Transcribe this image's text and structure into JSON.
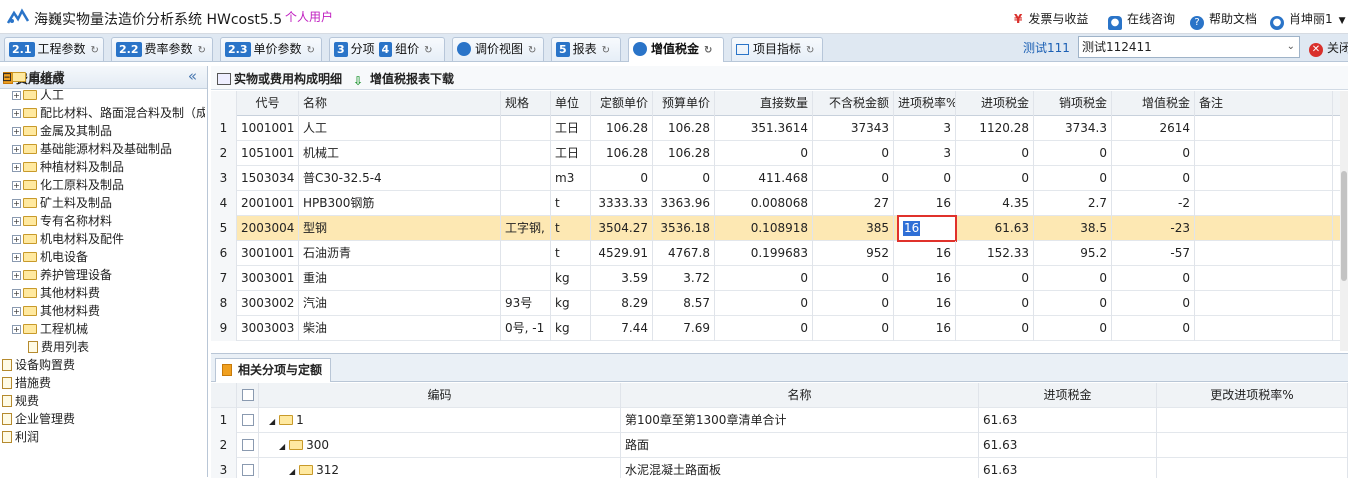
{
  "app": {
    "title": "海巍实物量法造价分析系统 HWcost5.5",
    "user_type": "个人用户"
  },
  "topbar": {
    "invoice": "发票与收益",
    "consult": "在线咨询",
    "help": "帮助文档",
    "user": "肖坤丽1"
  },
  "tabs": [
    {
      "num": "2.1",
      "label": "工程参数"
    },
    {
      "num": "2.2",
      "label": "费率参数"
    },
    {
      "num": "2.3",
      "label": "单价参数"
    },
    {
      "num": "3",
      "label": "分项"
    },
    {
      "num": "4",
      "label": "组价"
    },
    {
      "num": "",
      "label": "调价视图"
    },
    {
      "num": "5",
      "label": "报表"
    },
    {
      "num": "",
      "label": "增值税金"
    },
    {
      "num": "",
      "label": "项目指标"
    }
  ],
  "project": {
    "label": "测试111",
    "value": "测试112411",
    "close": "关闭"
  },
  "left": {
    "header": "费用组成",
    "root": "直接费",
    "items": [
      "人工",
      "配比材料、路面混合料及制（成）品",
      "金属及其制品",
      "基础能源材料及基础制品",
      "种植材料及制品",
      "化工原料及制品",
      "矿土料及制品",
      "专有名称材料",
      "机电材料及配件",
      "机电设备",
      "养护管理设备",
      "其他材料费",
      "其他材料费",
      "工程机械"
    ],
    "leaf": "费用列表",
    "tail": [
      "设备购置费",
      "措施费",
      "规费",
      "企业管理费",
      "利润"
    ]
  },
  "toolbar": {
    "detail": "实物或费用构成明细",
    "download": "增值税报表下载"
  },
  "grid": {
    "headers": [
      "代号",
      "名称",
      "规格",
      "单位",
      "定额单价",
      "预算单价",
      "直接数量",
      "不含税金额",
      "进项税率%",
      "进项税金",
      "销项税金",
      "增值税金",
      "备注"
    ],
    "rows": [
      {
        "n": "1",
        "code": "1001001",
        "name": "人工",
        "spec": "",
        "unit": "工日",
        "qp": "106.28",
        "bp": "106.28",
        "qty": "351.3614",
        "amt": "37343",
        "rate": "3",
        "in": "1120.28",
        "out": "3734.3",
        "vat": "2614"
      },
      {
        "n": "2",
        "code": "1051001",
        "name": "机械工",
        "spec": "",
        "unit": "工日",
        "qp": "106.28",
        "bp": "106.28",
        "qty": "0",
        "amt": "0",
        "rate": "3",
        "in": "0",
        "out": "0",
        "vat": "0"
      },
      {
        "n": "3",
        "code": "1503034",
        "name": "普C30-32.5-4",
        "spec": "",
        "unit": "m3",
        "qp": "0",
        "bp": "0",
        "qty": "411.468",
        "amt": "0",
        "rate": "0",
        "in": "0",
        "out": "0",
        "vat": "0"
      },
      {
        "n": "4",
        "code": "2001001",
        "name": "HPB300钢筋",
        "spec": "",
        "unit": "t",
        "qp": "3333.33",
        "bp": "3363.96",
        "qty": "0.008068",
        "amt": "27",
        "rate": "16",
        "in": "4.35",
        "out": "2.7",
        "vat": "-2"
      },
      {
        "n": "5",
        "code": "2003004",
        "name": "型钢",
        "spec": "工字钢,",
        "unit": "t",
        "qp": "3504.27",
        "bp": "3536.18",
        "qty": "0.108918",
        "amt": "385",
        "rate": "16",
        "in": "61.63",
        "out": "38.5",
        "vat": "-23"
      },
      {
        "n": "6",
        "code": "3001001",
        "name": "石油沥青",
        "spec": "",
        "unit": "t",
        "qp": "4529.91",
        "bp": "4767.8",
        "qty": "0.199683",
        "amt": "952",
        "rate": "16",
        "in": "152.33",
        "out": "95.2",
        "vat": "-57"
      },
      {
        "n": "7",
        "code": "3003001",
        "name": "重油",
        "spec": "",
        "unit": "kg",
        "qp": "3.59",
        "bp": "3.72",
        "qty": "0",
        "amt": "0",
        "rate": "16",
        "in": "0",
        "out": "0",
        "vat": "0"
      },
      {
        "n": "8",
        "code": "3003002",
        "name": "汽油",
        "spec": "93号",
        "unit": "kg",
        "qp": "8.29",
        "bp": "8.57",
        "qty": "0",
        "amt": "0",
        "rate": "16",
        "in": "0",
        "out": "0",
        "vat": "0"
      },
      {
        "n": "9",
        "code": "3003003",
        "name": "柴油",
        "spec": "0号, -1",
        "unit": "kg",
        "qp": "7.44",
        "bp": "7.69",
        "qty": "0",
        "amt": "0",
        "rate": "16",
        "in": "0",
        "out": "0",
        "vat": "0"
      }
    ],
    "editing_value": "16"
  },
  "bottom": {
    "tab": "相关分项与定额",
    "headers": [
      "编码",
      "名称",
      "进项税金",
      "更改进项税率%"
    ],
    "rows": [
      {
        "n": "1",
        "code": "1",
        "name": "第100章至第1300章清单合计",
        "tax": "61.63"
      },
      {
        "n": "2",
        "code": "300",
        "name": "路面",
        "tax": "61.63"
      },
      {
        "n": "3",
        "code": "312",
        "name": "水泥混凝土路面板",
        "tax": "61.63"
      }
    ]
  }
}
